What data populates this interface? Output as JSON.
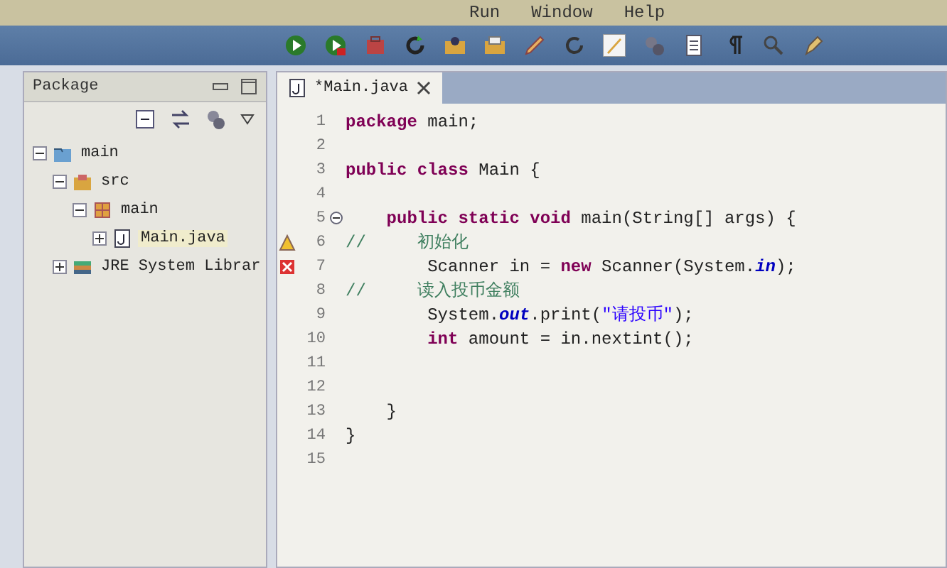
{
  "menu": [
    "Run",
    "Window",
    "Help"
  ],
  "explorer": {
    "tab": "Package",
    "tree": [
      {
        "label": "main",
        "kind": "project",
        "expanded": true,
        "children": [
          {
            "label": "src",
            "kind": "folder",
            "expanded": true,
            "children": [
              {
                "label": "main",
                "kind": "package",
                "expanded": true,
                "children": [
                  {
                    "label": "Main.java",
                    "kind": "file",
                    "expanded": false,
                    "selected": true
                  }
                ]
              }
            ]
          },
          {
            "label": "JRE System Librar",
            "kind": "library",
            "expanded": false,
            "selected": false
          }
        ]
      }
    ]
  },
  "editor": {
    "tab": "*Main.java",
    "lines": [
      {
        "number": "1",
        "segments": [
          {
            "kind": "keyword",
            "text": "package"
          },
          {
            "kind": "plain",
            "text": " main;"
          }
        ]
      },
      {
        "number": "2"
      },
      {
        "number": "3",
        "segments": [
          {
            "kind": "keyword",
            "text": "public class"
          },
          {
            "kind": "plain",
            "text": " Main {"
          }
        ]
      },
      {
        "number": "4"
      },
      {
        "number": "5",
        "fold": true,
        "segments": [
          {
            "kind": "keyword",
            "text": "    public static void"
          },
          {
            "kind": "plain",
            "text": " main(String[] args) {"
          }
        ]
      },
      {
        "number": "6",
        "warning": true,
        "segments": [
          {
            "kind": "comment",
            "text": "//     初始化"
          }
        ]
      },
      {
        "number": "7",
        "error": true,
        "segments": [
          {
            "kind": "plain",
            "text": "        Scanner in = "
          },
          {
            "kind": "keyword",
            "text": "new"
          },
          {
            "kind": "plain",
            "text": " Scanner(System."
          },
          {
            "kind": "field",
            "text": "in"
          },
          {
            "kind": "plain",
            "text": ");"
          }
        ]
      },
      {
        "number": "8",
        "segments": [
          {
            "kind": "comment",
            "text": "//     读入投币金额"
          }
        ]
      },
      {
        "number": "9",
        "segments": [
          {
            "kind": "plain",
            "text": "        System."
          },
          {
            "kind": "field",
            "text": "out"
          },
          {
            "kind": "plain",
            "text": ".print("
          },
          {
            "kind": "string",
            "text": "\"请投币\""
          },
          {
            "kind": "plain",
            "text": ");"
          }
        ]
      },
      {
        "number": "10",
        "segments": [
          {
            "kind": "keyword",
            "text": "        int"
          },
          {
            "kind": "plain",
            "text": " amount = in.nextint();"
          }
        ]
      },
      {
        "number": "11"
      },
      {
        "number": "12"
      },
      {
        "number": "13",
        "segments": [
          {
            "kind": "plain",
            "text": "    }"
          }
        ]
      },
      {
        "number": "14",
        "segments": [
          {
            "kind": "plain",
            "text": "}"
          }
        ]
      },
      {
        "number": "15"
      }
    ]
  }
}
